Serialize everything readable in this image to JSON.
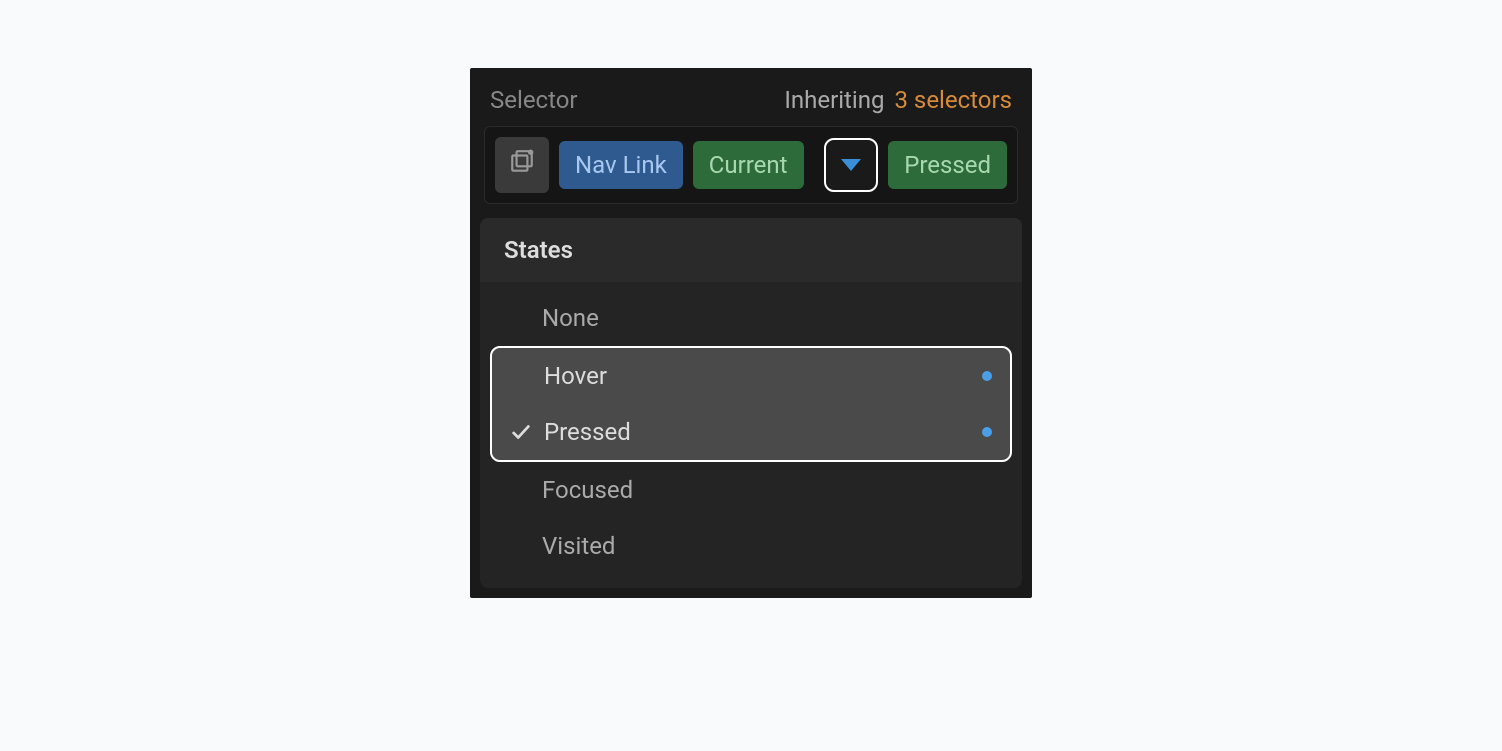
{
  "header": {
    "label": "Selector",
    "inheriting_label": "Inheriting",
    "inheriting_count": "3 selectors"
  },
  "tokens": {
    "nav_link": "Nav Link",
    "current": "Current",
    "pressed": "Pressed"
  },
  "states": {
    "heading": "States",
    "none": "None",
    "hover": "Hover",
    "pressed": "Pressed",
    "focused": "Focused",
    "visited": "Visited"
  }
}
